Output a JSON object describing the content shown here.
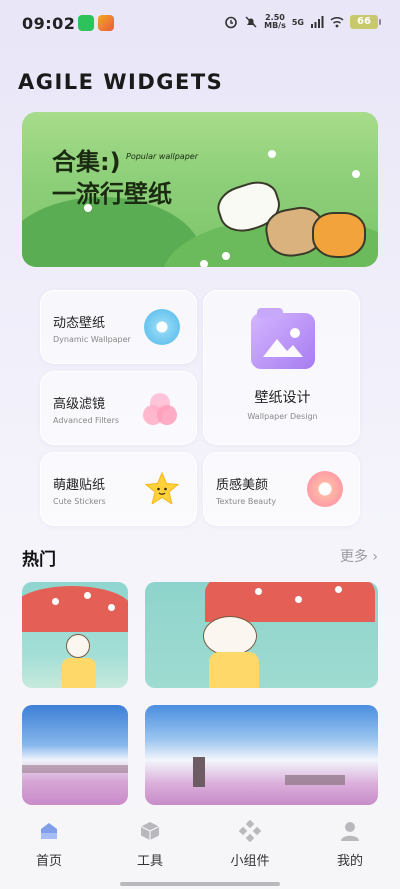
{
  "status_bar": {
    "time": "09:02",
    "net_speed_value": "2.50",
    "net_speed_unit": "MB/s",
    "signal": "5G",
    "battery": "66"
  },
  "header": {
    "title": "AGILE WIDGETS"
  },
  "banner": {
    "line1": "合集:)",
    "subtitle": "Popular wallpaper",
    "line2": "一流行壁纸"
  },
  "features": {
    "dynamic": {
      "title": "动态壁纸",
      "subtitle": "Dynamic Wallpaper"
    },
    "wallpaper_design": {
      "title": "壁纸设计",
      "subtitle": "Wallpaper Design"
    },
    "filters": {
      "title": "高级滤镜",
      "subtitle": "Advanced Filters"
    },
    "stickers": {
      "title": "萌趣贴纸",
      "subtitle": "Cute Stickers"
    },
    "beauty": {
      "title": "质感美颜",
      "subtitle": "Texture Beauty"
    }
  },
  "hot": {
    "title": "热门",
    "more": "更多 ›"
  },
  "nav": {
    "home": "首页",
    "tools": "工具",
    "widgets": "小组件",
    "mine": "我的"
  },
  "colors": {
    "accent": "#6b8ee8",
    "banner_bg": "#8fd07a",
    "nav_bg": "#f6f6f8"
  }
}
